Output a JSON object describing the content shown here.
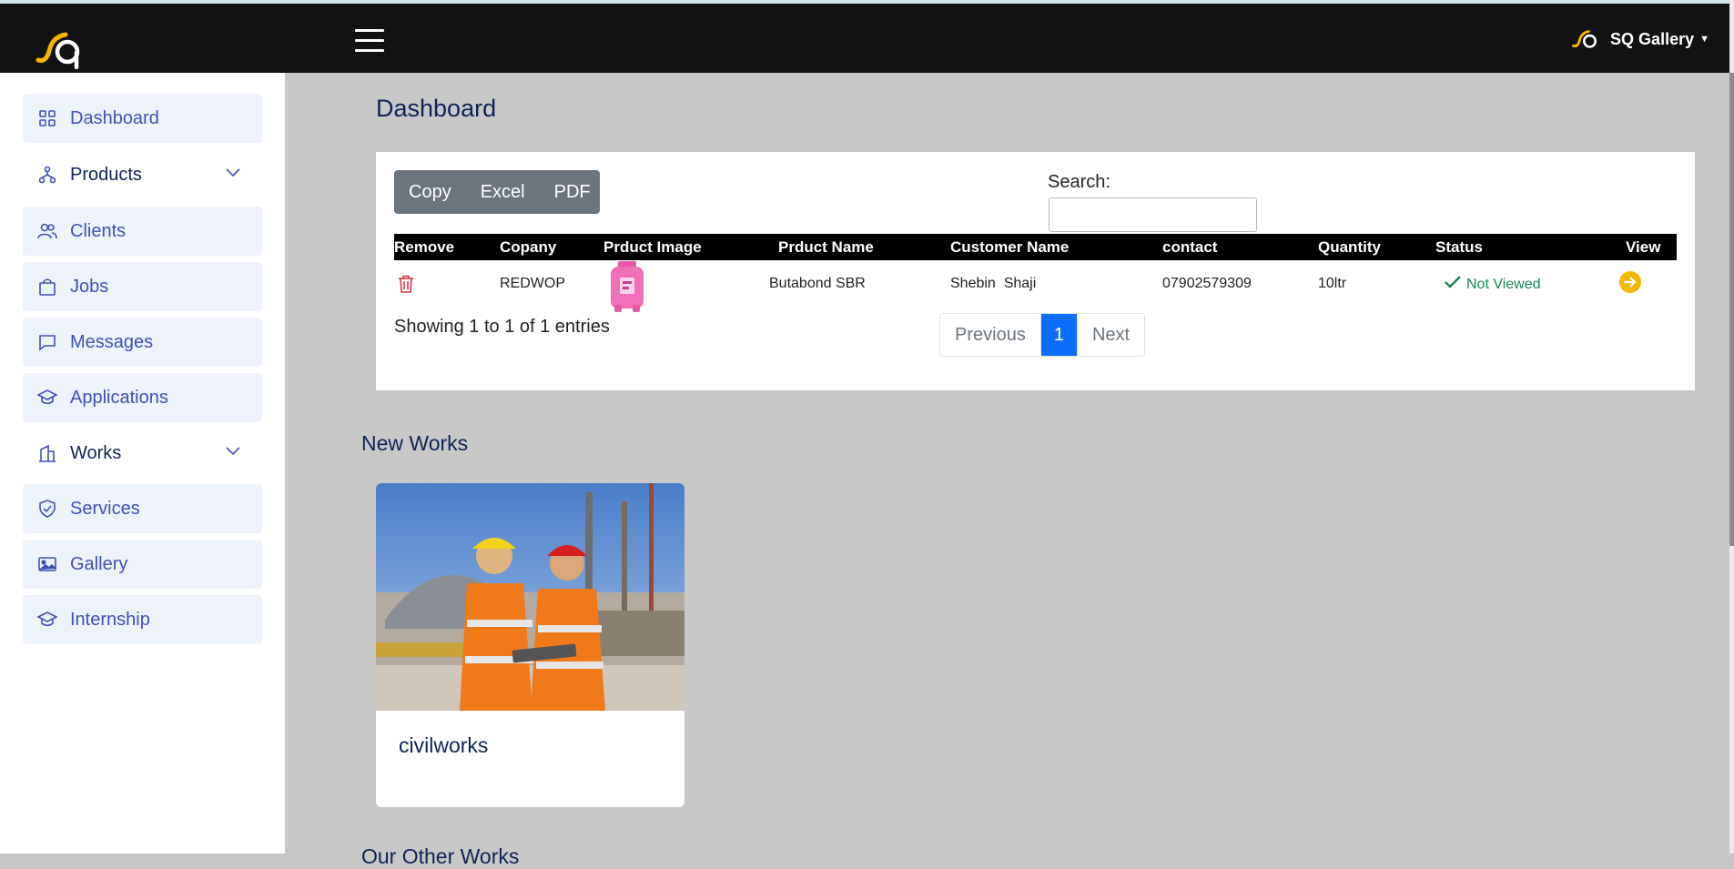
{
  "header": {
    "brand": "SQ Gallery",
    "logo_icon": "sq-logo-icon",
    "menu_icon": "hamburger-icon",
    "accent": "#f7b500"
  },
  "sidebar": {
    "items": [
      {
        "label": "Dashboard",
        "icon": "grid-icon"
      },
      {
        "label": "Products",
        "icon": "hierarchy-icon"
      },
      {
        "label": "Clients",
        "icon": "users-icon"
      },
      {
        "label": "Jobs",
        "icon": "bag-icon"
      },
      {
        "label": "Messages",
        "icon": "chat-icon"
      },
      {
        "label": "Applications",
        "icon": "graduation-cap-icon"
      },
      {
        "label": "Works",
        "icon": "building-icon"
      },
      {
        "label": "Services",
        "icon": "shield-icon"
      },
      {
        "label": "Gallery",
        "icon": "image-icon"
      },
      {
        "label": "Internship",
        "icon": "graduation-cap-icon"
      }
    ]
  },
  "main": {
    "title": "Dashboard",
    "export_buttons": [
      "Copy",
      "Excel",
      "PDF"
    ],
    "search_label": "Search:",
    "search_value": "",
    "table": {
      "headers": [
        "Remove",
        "Copany",
        "Prduct Image",
        "Prduct Name",
        "Customer Name",
        "contact",
        "Quantity",
        "Status",
        "View"
      ],
      "rows": [
        {
          "company": "REDWOP",
          "product_name": "Butabond SBR",
          "customer": "Shebin  Shaji",
          "contact": "07902579309",
          "quantity": "10ltr",
          "status": "Not Viewed"
        }
      ]
    },
    "showing": "Showing 1 to 1 of 1 entries",
    "pagination": {
      "previous": "Previous",
      "current": "1",
      "next": "Next"
    },
    "new_works_title": "New Works",
    "works": [
      {
        "name": "civilworks"
      }
    ],
    "next_section_title": "Our Other Works"
  },
  "colors": {
    "topbar": "#121212",
    "sidebar_text": "#3f51b5",
    "heading": "#0f2356",
    "status_green": "#198754",
    "page_active": "#0d6efd",
    "trash_red": "#dc3545",
    "view_yellow": "#f5b800"
  }
}
